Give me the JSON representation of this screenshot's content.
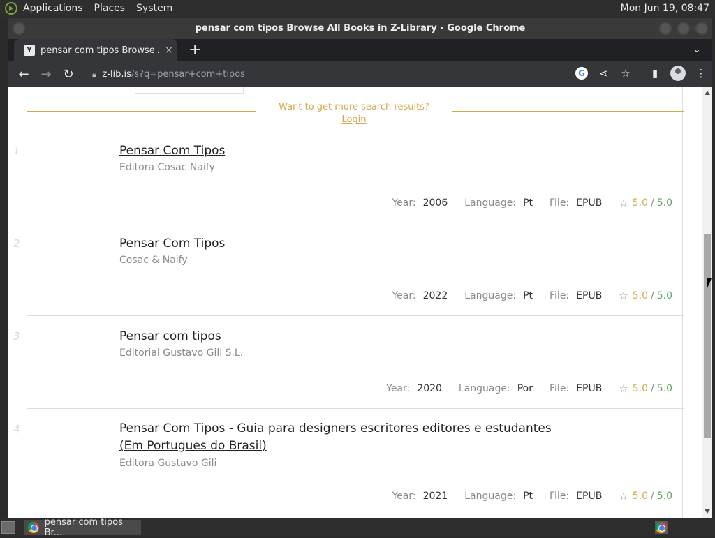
{
  "top_panel": {
    "menus": [
      "Applications",
      "Places",
      "System"
    ],
    "clock": "Mon Jun 19, 08:47"
  },
  "window": {
    "title": "pensar com tipos Browse All Books in Z-Library - Google Chrome"
  },
  "tab": {
    "favicon": "Y",
    "title": "pensar com tipos Browse All B",
    "close": "×"
  },
  "toolbar": {
    "new_tab": "+",
    "tab_menu": "⌄",
    "back": "←",
    "forward": "→",
    "reload": "↻",
    "url_host": "z-lib.is",
    "url_path": "/s?q=pensar+com+tipos",
    "lock_icon": "lock-icon"
  },
  "promo": {
    "text": "Want to get more search results?",
    "login": "Login"
  },
  "colors": {
    "accent": "#d4a94a",
    "rating_green": "#5ba85b"
  },
  "results": [
    {
      "num": "1",
      "title": "Pensar Com Tipos",
      "publisher": "Editora Cosac Naify",
      "year_label": "Year:",
      "year": "2006",
      "lang_label": "Language:",
      "lang": "Pt",
      "file_label": "File:",
      "file": "EPUB",
      "rating1": "5.0",
      "rating2": "5.0"
    },
    {
      "num": "2",
      "title": "Pensar Com Tipos",
      "publisher": "Cosac & Naify",
      "year_label": "Year:",
      "year": "2022",
      "lang_label": "Language:",
      "lang": "Pt",
      "file_label": "File:",
      "file": "EPUB",
      "rating1": "5.0",
      "rating2": "5.0"
    },
    {
      "num": "3",
      "title": "Pensar com tipos",
      "publisher": "Editorial Gustavo Gili S.L.",
      "year_label": "Year:",
      "year": "2020",
      "lang_label": "Language:",
      "lang": "Por",
      "file_label": "File:",
      "file": "EPUB",
      "rating1": "5.0",
      "rating2": "5.0"
    },
    {
      "num": "4",
      "title": "Pensar Com Tipos - Guia para designers escritores editores e estudantes (Em Portugues do Brasil)",
      "publisher": "Editora Gustavo Gili",
      "year_label": "Year:",
      "year": "2021",
      "lang_label": "Language:",
      "lang": "Pt",
      "file_label": "File:",
      "file": "EPUB",
      "rating1": "5.0",
      "rating2": "5.0"
    }
  ],
  "taskbar": {
    "item_label": "pensar com tipos Br..."
  }
}
